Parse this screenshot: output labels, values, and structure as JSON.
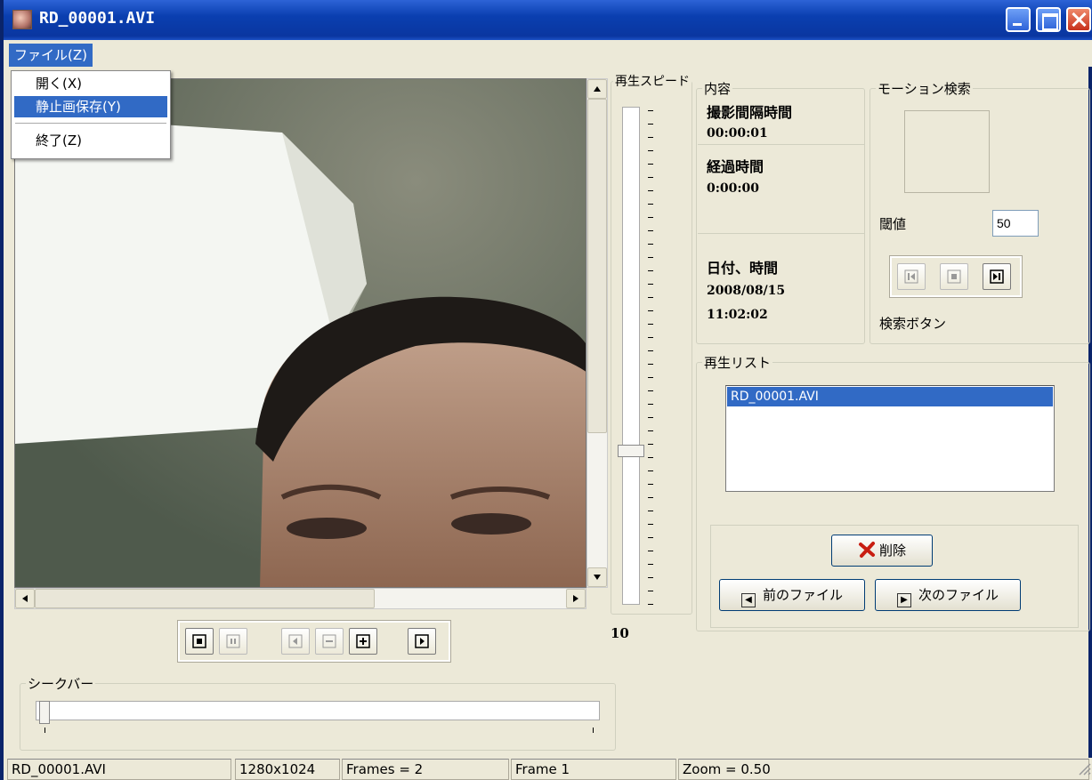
{
  "window": {
    "title": "RD_00001.AVI"
  },
  "menu": {
    "file_label": "ファイル(Z)",
    "items": [
      "開く(X)",
      "静止画保存(Y)",
      "終了(Z)"
    ]
  },
  "playback_controls": {
    "buttons": [
      "stop",
      "pause",
      "prev-frame",
      "zoom-out",
      "zoom-in",
      "next-frame"
    ]
  },
  "seekbar": {
    "label": "シークバー",
    "position": 0
  },
  "speed": {
    "label": "再生スピード",
    "value": "10",
    "level": 0.5
  },
  "content": {
    "label": "内容",
    "interval_label": "撮影間隔時間",
    "interval_value": "00:00:01",
    "elapsed_label": "経過時間",
    "elapsed_value": "0:00:00",
    "datetime_label": "日付、時間",
    "date_value": "2008/08/15",
    "time_value": "11:02:02"
  },
  "motion": {
    "label": "モーション検索",
    "threshold_label": "閾値",
    "threshold_value": "50",
    "search_label": "検索ボタン"
  },
  "playlist": {
    "label": "再生リスト",
    "items": [
      "RD_00001.AVI"
    ],
    "delete_label": "削除",
    "prev_file_label": "前のファイル",
    "next_file_label": "次のファイル"
  },
  "status": {
    "filename": "RD_00001.AVI",
    "resolution": "1280x1024",
    "frames": "Frames = 2",
    "frame": "Frame 1",
    "zoom": "Zoom = 0.50"
  }
}
